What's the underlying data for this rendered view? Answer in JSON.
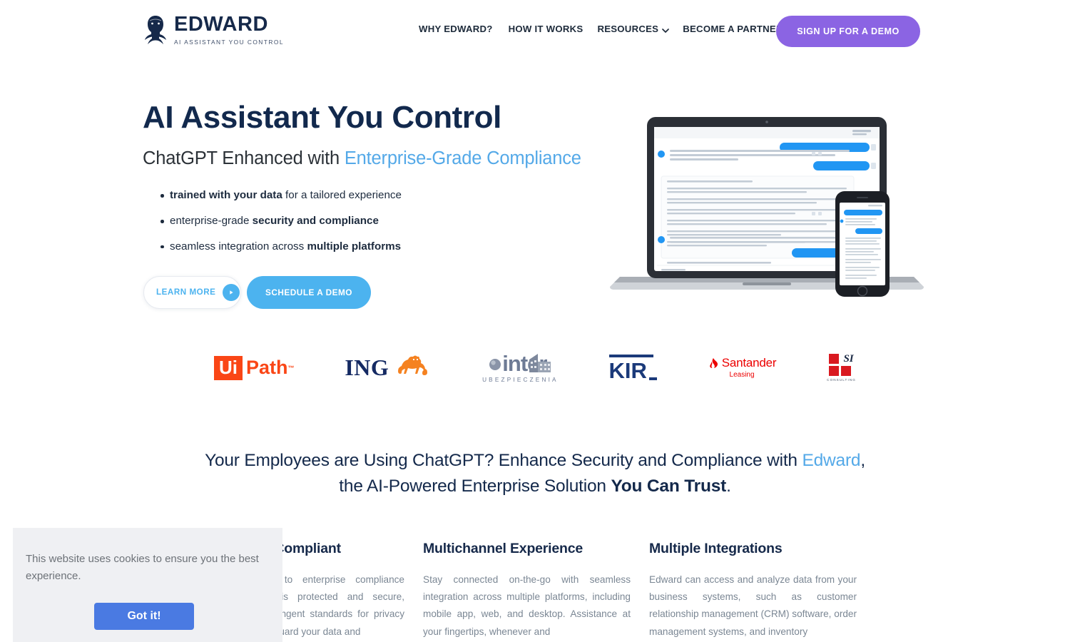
{
  "header": {
    "logo": {
      "icon": "head-silhouette-icon",
      "title": "EDWARD",
      "tagline": "AI ASSISTANT YOU CONTROL"
    },
    "nav": [
      {
        "label": "WHY EDWARD?",
        "has_dropdown": false
      },
      {
        "label": "HOW IT WORKS",
        "has_dropdown": false
      },
      {
        "label": "RESOURCES",
        "has_dropdown": true
      },
      {
        "label": "BECOME A PARTNER",
        "has_dropdown": false
      }
    ],
    "cta": {
      "label": "SIGN UP FOR A DEMO",
      "color": "#8b64e3"
    }
  },
  "hero": {
    "title": "AI Assistant You Control",
    "subtitle_plain": "ChatGPT Enhanced with ",
    "subtitle_accent": "Enterprise-Grade Compliance",
    "bullets": [
      {
        "bold_lead": "trained with your data",
        "rest": " for a tailored experience",
        "lead_bold": true
      },
      {
        "lead": "enterprise-grade ",
        "bold_tail": "security and compliance",
        "lead_bold": false
      },
      {
        "lead": "seamless integration across ",
        "bold_tail": "multiple platforms",
        "lead_bold": false
      }
    ],
    "buttons": {
      "learn_more": "LEARN MORE",
      "learn_more_icon": "play-circle-icon",
      "schedule_demo": "SCHEDULE A DEMO"
    },
    "device_mockup_alt": "laptop and smartphone showing Edward chat interface"
  },
  "clients": {
    "uipath": {
      "ui": "Ui",
      "path": "Path",
      "tm": "™",
      "color": "#fa4616"
    },
    "ing": {
      "name": "ING",
      "color": "#152a63",
      "mascot": "lion-icon"
    },
    "inter": {
      "name": "inter",
      "sub": "UBEZPIECZENIA",
      "color": "#6e7b95"
    },
    "kir": {
      "name": "KIR",
      "color": "#1b3a7a"
    },
    "santander": {
      "name": "Santander",
      "sub": "Leasing",
      "color": "#ec0000",
      "icon": "flame-icon"
    },
    "si": {
      "name": "SI",
      "sub": "CONSULTING",
      "color": "#d91920"
    }
  },
  "mid_headline": {
    "line1_a": "Your Employees are Using ChatGPT? Enhance Security and Compliance with ",
    "line1_accent": "Edward",
    "line1_b": ",",
    "line2_a": "the AI-Powered Enterprise Solution ",
    "line2_bold": "You Can Trust",
    "line2_b": "."
  },
  "features": [
    {
      "title": "Secure and Compliant",
      "body": "Edward adheres to enterprise compliance standards. Data is protected and secure, complying with stringent standards for privacy and security. Safeguard your data and"
    },
    {
      "title": "Multichannel Experience",
      "body": "Stay connected on-the-go with seamless integration across multiple platforms, including mobile app, web, and desktop. Assistance at your fingertips, whenever and"
    },
    {
      "title": "Multiple Integrations",
      "body": "Edward can access and analyze data from your business systems, such as customer relationship management (CRM) software, order management systems, and inventory"
    }
  ],
  "cookie_banner": {
    "message": "This website uses cookies to ensure you the best experience.",
    "accept_label": "Got it!",
    "accept_color": "#4a7ae2",
    "background": "#eff0f3"
  },
  "colors": {
    "navy": "#12294d",
    "light_blue": "#54a9e8",
    "button_blue": "#4cb3ef",
    "purple": "#8b64e3",
    "body_gray": "#7b8794"
  }
}
